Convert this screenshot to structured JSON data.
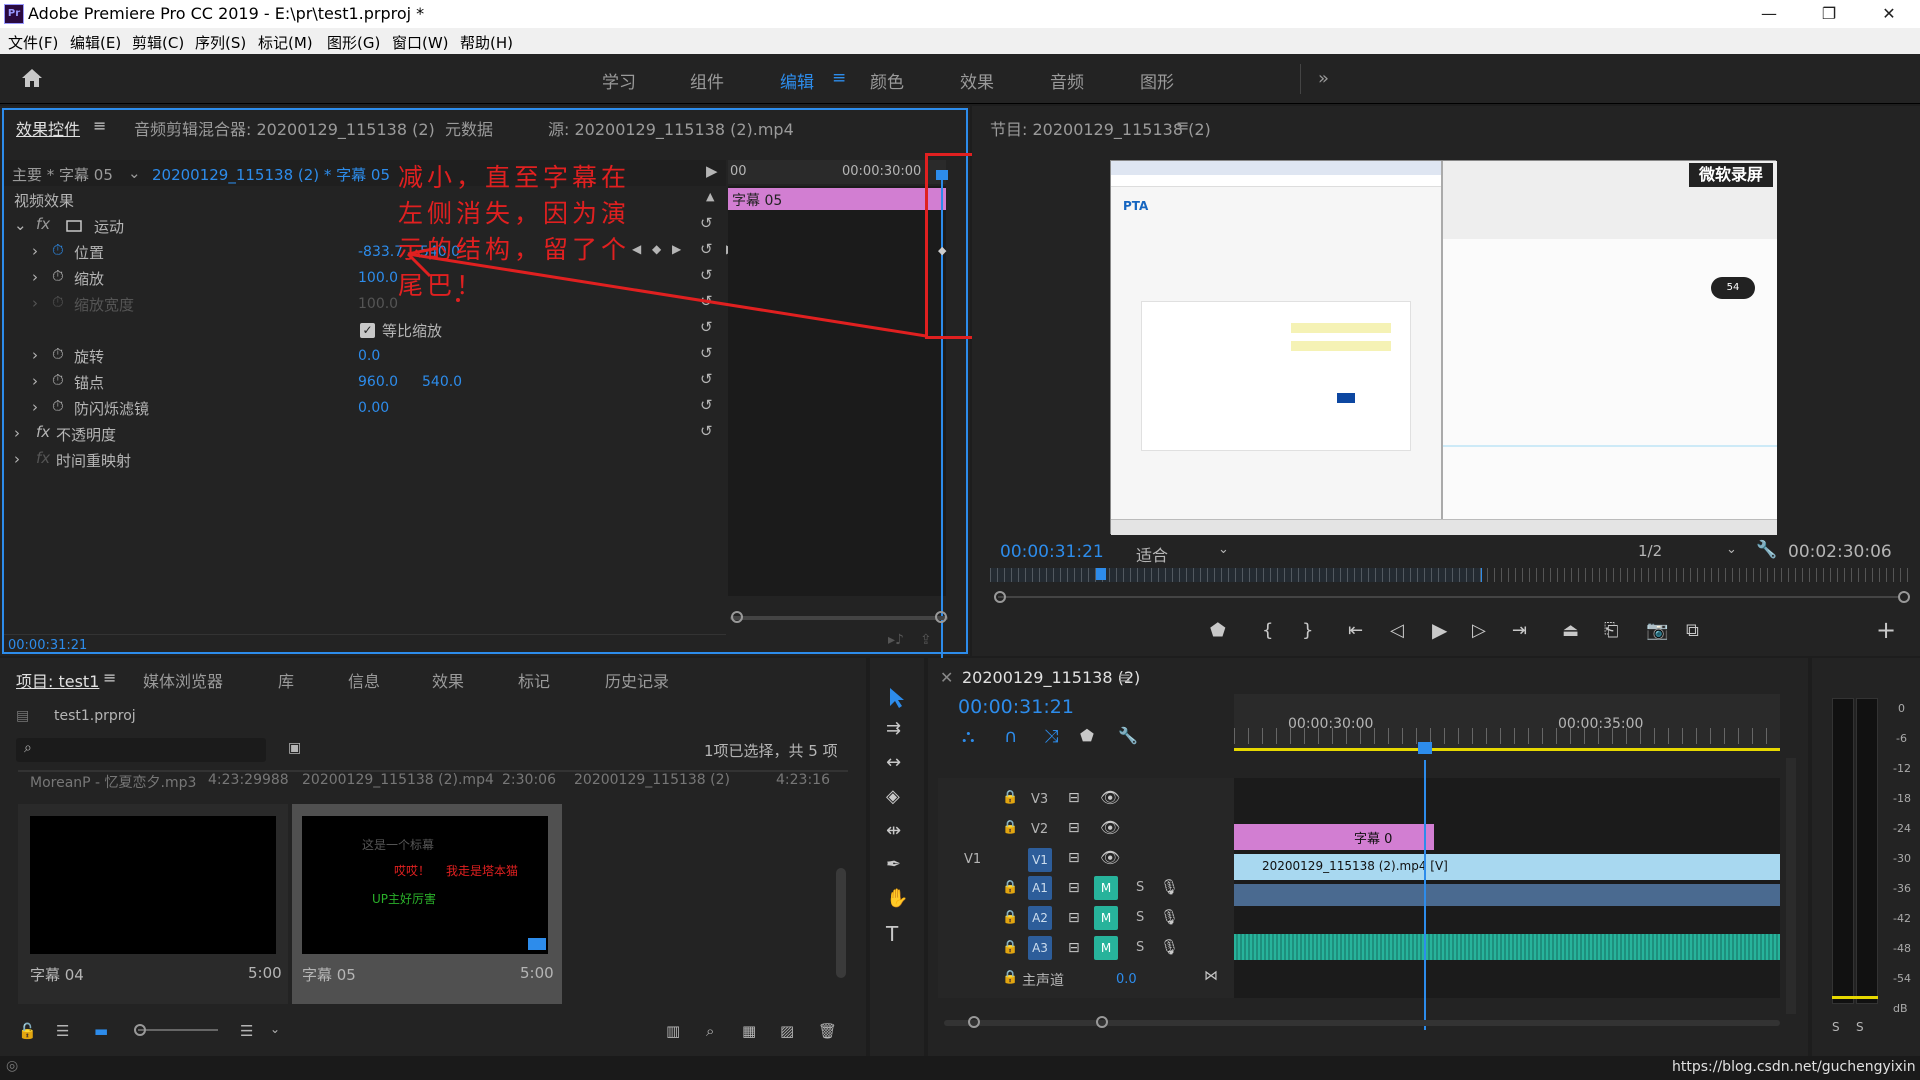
{
  "window": {
    "title": "Adobe Premiere Pro CC 2019 - E:\\pr\\test1.prproj *",
    "logo": "Pr"
  },
  "menu": [
    "文件(F)",
    "编辑(E)",
    "剪辑(C)",
    "序列(S)",
    "标记(M)",
    "图形(G)",
    "窗口(W)",
    "帮助(H)"
  ],
  "workspaces": [
    "学习",
    "组件",
    "编辑",
    "颜色",
    "效果",
    "音频",
    "图形"
  ],
  "top_left_panel": {
    "tabs": [
      "效果控件",
      "音频剪辑混合器: 20200129_115138 (2)",
      "元数据",
      "源: 20200129_115138 (2).mp4"
    ],
    "master_label": "主要 * 字幕 05",
    "clip_label": "20200129_115138 (2) * 字幕 05",
    "section": "视频效果",
    "motion": "运动",
    "position_label": "位置",
    "position_x": "-833.7",
    "position_y": "540.0",
    "scale_label": "缩放",
    "scale_value": "100.0",
    "scale_width_label": "缩放宽度",
    "scale_width_value": "100.0",
    "uniform_scale": "等比缩放",
    "rotation_label": "旋转",
    "rotation_value": "0.0",
    "anchor_label": "锚点",
    "anchor_x": "960.0",
    "anchor_y": "540.0",
    "flicker_label": "防闪烁滤镜",
    "flicker_value": "0.00",
    "opacity_label": "不透明度",
    "timeremap_label": "时间重映射",
    "mini_time_start": "00",
    "mini_time_mark": "00:00:30:00",
    "mini_clip": "字幕 05",
    "timecode": "00:00:31:21"
  },
  "annotation": {
    "text": "减小，直至字幕在左侧消失，因为演示的结构，留了个尾巴！"
  },
  "program_monitor": {
    "title": "节目: 20200129_115138 (2)",
    "timecode": "00:00:31:21",
    "fit": "适合",
    "quality": "1/2",
    "duration": "00:02:30:06",
    "watermark": "微软录屏",
    "preview_brand": "PTA",
    "preview_badge": "54"
  },
  "project_panel": {
    "tabs": [
      "项目: test1",
      "媒体浏览器",
      "库",
      "信息",
      "效果",
      "标记",
      "历史记录"
    ],
    "filename": "test1.prproj",
    "status": "1项已选择，共 5 项",
    "list_row": [
      "MoreanP - 忆夏恋夕.mp3",
      "4:23:29988",
      "20200129_115138 (2).mp4",
      "2:30:06",
      "20200129_115138 (2)",
      "4:23:16"
    ],
    "items": [
      {
        "name": "字幕 04",
        "duration": "5:00"
      },
      {
        "name": "字幕 05",
        "duration": "5:00"
      }
    ],
    "thumb_text": [
      "这是一个标幕",
      "哎哎！",
      "我走是塔本猫",
      "UP主好厉害"
    ]
  },
  "timeline": {
    "title": "20200129_115138 (2)",
    "timecode": "00:00:31:21",
    "ruler": [
      "00:00:30:00",
      "00:00:35:00"
    ],
    "video_tracks": [
      "V3",
      "V2",
      "V1"
    ],
    "source_v": "V1",
    "audio_tracks": [
      "A1",
      "A2",
      "A3"
    ],
    "master": "主声道",
    "master_value": "0.0",
    "clip_title": "字幕 0",
    "clip_video": "20200129_115138 (2).mp4 [V]"
  },
  "meter": {
    "labels": [
      "0",
      "-6",
      "-12",
      "-18",
      "-24",
      "-30",
      "-36",
      "-42",
      "-48",
      "-54",
      "dB"
    ],
    "solo": "S"
  },
  "footer": {
    "url": "https://blog.csdn.net/guchengyixin"
  },
  "colors": {
    "accent": "#2d8ceb",
    "annotation": "#e02020",
    "clip_pink": "#d27ed2",
    "clip_blue": "#a8d8f0",
    "audio_green": "#27b39b"
  }
}
